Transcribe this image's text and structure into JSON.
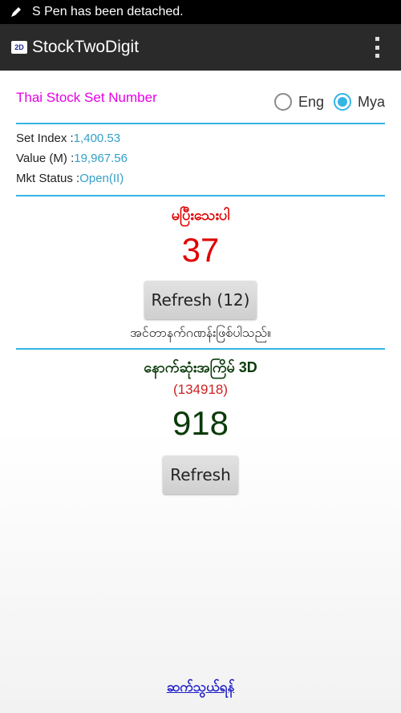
{
  "status_bar": {
    "notification": "S Pen has been detached."
  },
  "action_bar": {
    "logo_text": "2D",
    "title": "StockTwoDigit"
  },
  "heading": "Thai Stock Set Number",
  "language": {
    "options": [
      "Eng",
      "Mya"
    ],
    "selected": "Mya"
  },
  "market": {
    "set_index_label": "Set Index :",
    "set_index_value": "1,400.53",
    "value_label": "Value (M) :",
    "value_value": "19,967.56",
    "status_label": "Mkt Status :",
    "status_value": "Open(II)"
  },
  "two_digit": {
    "title": "မပြီးသေးပါ",
    "number": "37",
    "refresh_label": "Refresh (12)",
    "note": "အင်တာနက်ဂဏန်းဖြစ်ပါသည်။"
  },
  "three_digit": {
    "title": "နောက်ဆုံးအကြိမ် 3D",
    "code": "(134918)",
    "number": "918",
    "refresh_label": "Refresh"
  },
  "footer": {
    "contact_link": "ဆက်သွယ်ရန်"
  },
  "colors": {
    "accent": "#33b5e5",
    "heading": "#e600e6",
    "red": "#e00000",
    "green": "#0a3a0a",
    "link": "#1c1cc8"
  }
}
